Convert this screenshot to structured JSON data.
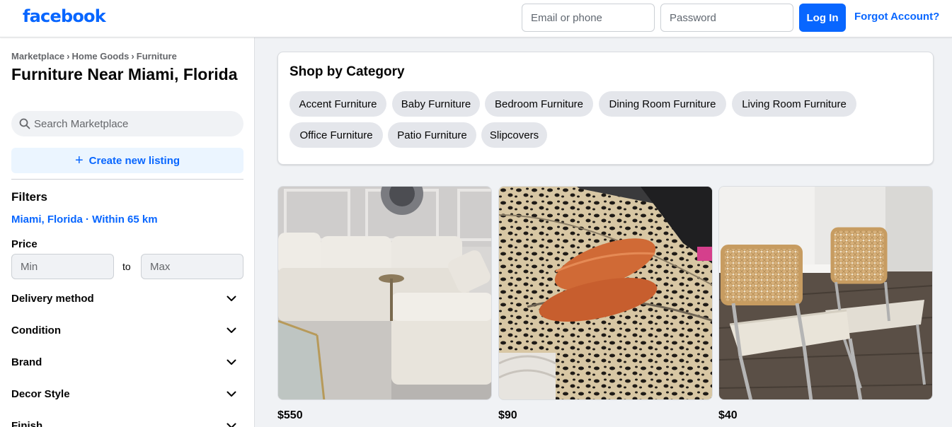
{
  "header": {
    "logo": "facebook",
    "email_placeholder": "Email or phone",
    "password_placeholder": "Password",
    "login_label": "Log In",
    "forgot_label": "Forgot Account?",
    "brand_color": "#0866ff"
  },
  "sidebar": {
    "breadcrumb": [
      "Marketplace",
      "Home Goods",
      "Furniture"
    ],
    "title": "Furniture Near Miami, Florida",
    "search_placeholder": "Search Marketplace",
    "create_label": "Create new listing",
    "filters_title": "Filters",
    "location": "Miami, Florida · Within 65 km",
    "price_label": "Price",
    "price_min_placeholder": "Min",
    "price_to": "to",
    "price_max_placeholder": "Max",
    "filters": [
      "Delivery method",
      "Condition",
      "Brand",
      "Decor Style",
      "Finish"
    ]
  },
  "categories": {
    "title": "Shop by Category",
    "chips": [
      "Accent Furniture",
      "Baby Furniture",
      "Bedroom Furniture",
      "Dining Room Furniture",
      "Living Room Furniture",
      "Office Furniture",
      "Patio Furniture",
      "Slipcovers"
    ]
  },
  "listings": [
    {
      "price": "$550",
      "image": "white-sectional-sofa"
    },
    {
      "price": "$90",
      "image": "leopard-print-sofa-orange-pillows"
    },
    {
      "price": "$40",
      "image": "cane-back-dining-chairs"
    }
  ]
}
